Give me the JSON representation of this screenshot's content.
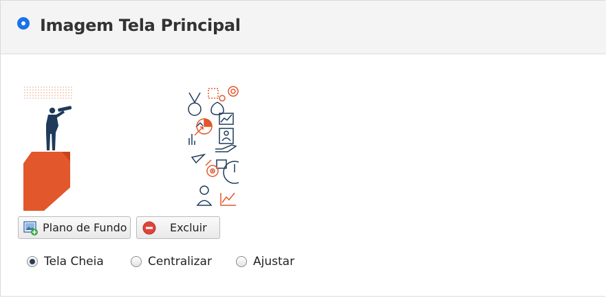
{
  "panel": {
    "title": "Imagem Tela Principal",
    "header_selected": true
  },
  "images": [
    {
      "name": "background-image-thumbnail",
      "icon": "man-with-telescope-on-arrow"
    },
    {
      "name": "background-image-thumbnail-2",
      "icon": "business-icons-collage"
    }
  ],
  "buttons": {
    "background_label": "Plano de Fundo",
    "delete_label": "Excluir"
  },
  "display_mode": {
    "options": [
      "Tela Cheia",
      "Centralizar",
      "Ajustar"
    ],
    "selected": "Tela Cheia"
  },
  "colors": {
    "accent": "#1a73e8",
    "orange": "#e2572b",
    "navy": "#1f3a5a"
  }
}
